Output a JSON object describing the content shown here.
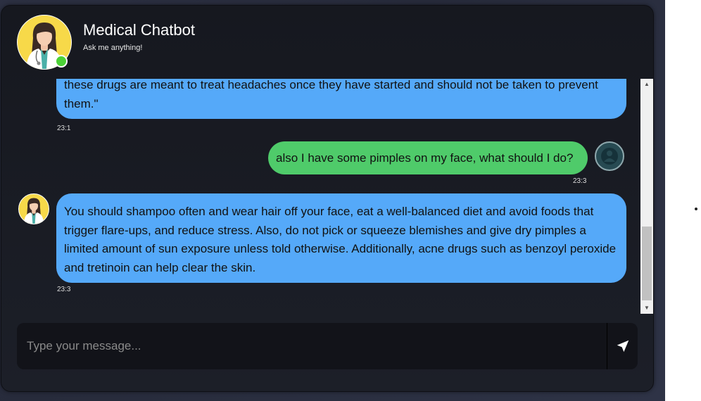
{
  "header": {
    "title": "Medical Chatbot",
    "subtitle": "Ask me anything!",
    "avatar_icon": "doctor-avatar-icon",
    "status": "online"
  },
  "messages": [
    {
      "sender": "bot",
      "text": "these drugs are meant to treat headaches once they have started and should not be taken to prevent them.\"",
      "time": "23:1"
    },
    {
      "sender": "user",
      "text": "also I have some pimples on my face, what should I do?",
      "time": "23:3"
    },
    {
      "sender": "bot",
      "text": "You should shampoo often and wear hair off your face, eat a well-balanced diet and avoid foods that trigger flare-ups, and reduce stress. Also, do not pick or squeeze blemishes and give dry pimples a limited amount of sun exposure unless told otherwise. Additionally, acne drugs such as benzoyl peroxide and tretinoin can help clear the skin.",
      "time": "23:3"
    }
  ],
  "composer": {
    "placeholder": "Type your message...",
    "send_icon": "send-icon"
  },
  "colors": {
    "bot_bubble": "#55a9f9",
    "user_bubble": "#4fcb6a",
    "online": "#4cd137"
  }
}
